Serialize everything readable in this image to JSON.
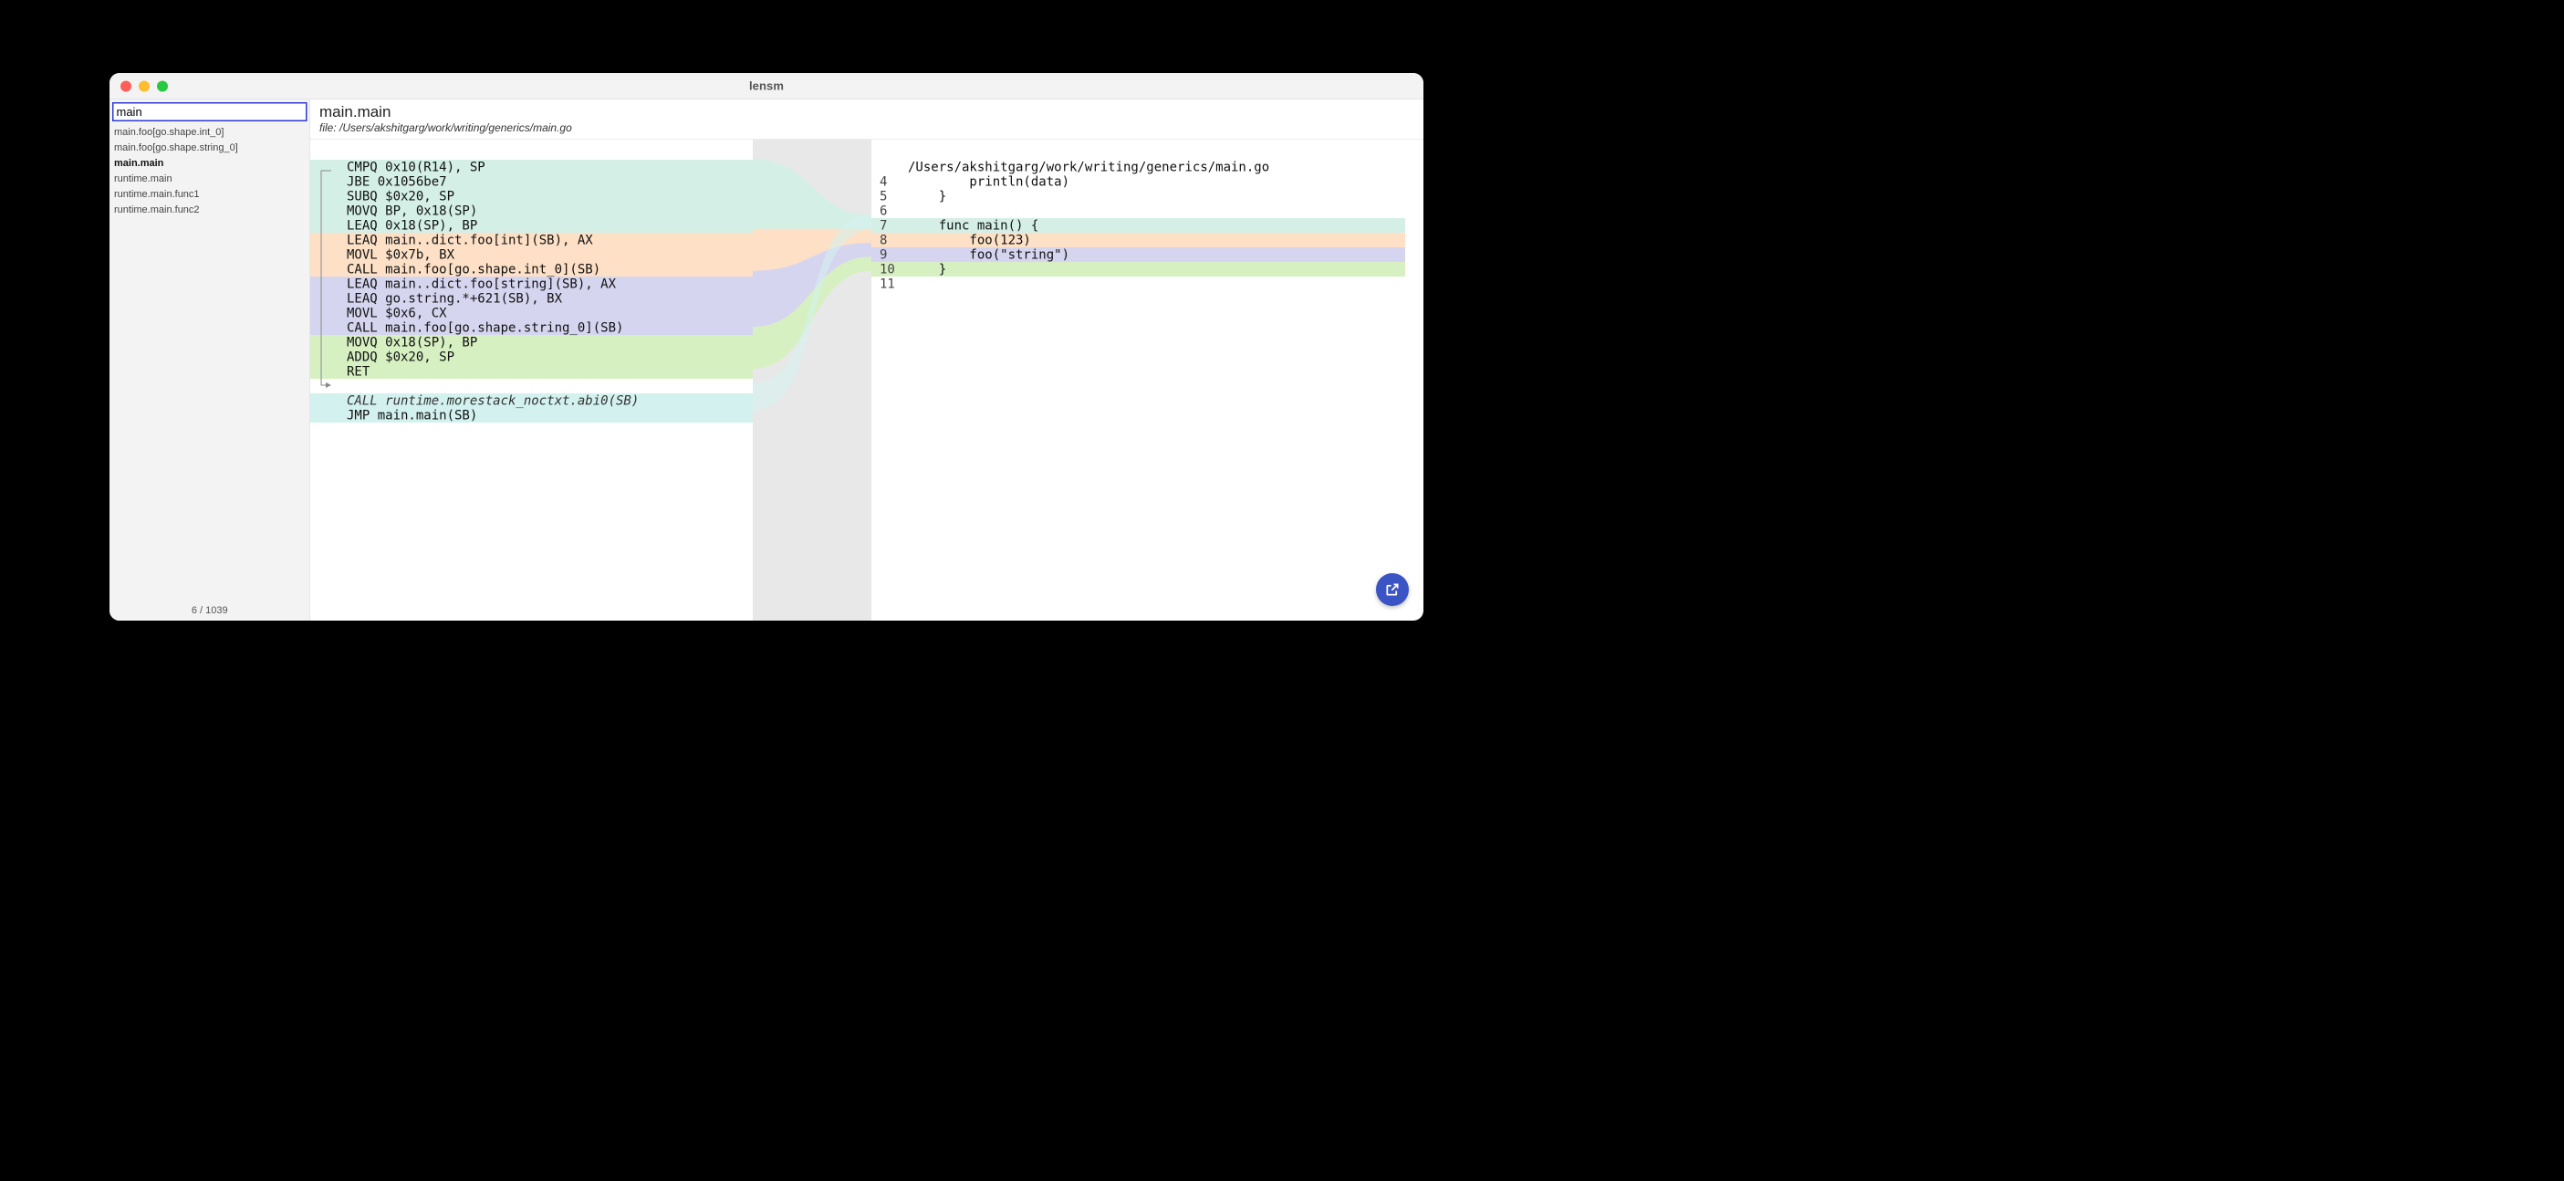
{
  "window": {
    "title": "lensm"
  },
  "sidebar": {
    "search_value": "main",
    "items": [
      {
        "label": "main.foo[go.shape.int_0]",
        "selected": false
      },
      {
        "label": "main.foo[go.shape.string_0]",
        "selected": false
      },
      {
        "label": "main.main",
        "selected": true
      },
      {
        "label": "runtime.main",
        "selected": false
      },
      {
        "label": "runtime.main.func1",
        "selected": false
      },
      {
        "label": "runtime.main.func2",
        "selected": false
      }
    ],
    "footer": "6 / 1039"
  },
  "main": {
    "function_name": "main.main",
    "file_label": "file: /Users/akshitgarg/work/writing/generics/main.go"
  },
  "asm": [
    {
      "text": "CMPQ 0x10(R14), SP",
      "cls": "bg-teal"
    },
    {
      "text": "JBE 0x1056be7",
      "cls": "bg-teal"
    },
    {
      "text": "SUBQ $0x20, SP",
      "cls": "bg-teal"
    },
    {
      "text": "MOVQ BP, 0x18(SP)",
      "cls": "bg-teal"
    },
    {
      "text": "LEAQ 0x18(SP), BP",
      "cls": "bg-teal"
    },
    {
      "text": "LEAQ main..dict.foo[int](SB), AX",
      "cls": "bg-orange"
    },
    {
      "text": "MOVL $0x7b, BX",
      "cls": "bg-orange"
    },
    {
      "text": "CALL main.foo[go.shape.int_0](SB)",
      "cls": "bg-orange"
    },
    {
      "text": "LEAQ main..dict.foo[string](SB), AX",
      "cls": "bg-purple"
    },
    {
      "text": "LEAQ go.string.*+621(SB), BX",
      "cls": "bg-purple"
    },
    {
      "text": "MOVL $0x6, CX",
      "cls": "bg-purple"
    },
    {
      "text": "CALL main.foo[go.shape.string_0](SB)",
      "cls": "bg-purple"
    },
    {
      "text": "MOVQ 0x18(SP), BP",
      "cls": "bg-green"
    },
    {
      "text": "ADDQ $0x20, SP",
      "cls": "bg-green"
    },
    {
      "text": "RET",
      "cls": "bg-green"
    },
    {
      "text": "",
      "cls": "spacer"
    },
    {
      "text": "CALL runtime.morestack_noctxt.abi0(SB)",
      "cls": "bg-cyan italic"
    },
    {
      "text": "JMP main.main(SB)",
      "cls": "bg-cyan"
    }
  ],
  "src": [
    {
      "ln": "",
      "code": "/Users/akshitgarg/work/writing/generics/main.go",
      "cls": ""
    },
    {
      "ln": "4",
      "code": "        println(data)",
      "cls": ""
    },
    {
      "ln": "5",
      "code": "    }",
      "cls": ""
    },
    {
      "ln": "6",
      "code": "",
      "cls": ""
    },
    {
      "ln": "7",
      "code": "    func main() {",
      "cls": "bg-teal"
    },
    {
      "ln": "8",
      "code": "        foo(123)",
      "cls": "bg-orange"
    },
    {
      "ln": "9",
      "code": "        foo(\"string\")",
      "cls": "bg-purple"
    },
    {
      "ln": "10",
      "code": "    }",
      "cls": "bg-green"
    },
    {
      "ln": "11",
      "code": "",
      "cls": ""
    }
  ],
  "colors": {
    "teal": "#d4efe6",
    "orange": "#fde0c6",
    "purple": "#d6d5f0",
    "green": "#d6f0c2",
    "cyan": "#d3f2ef"
  }
}
